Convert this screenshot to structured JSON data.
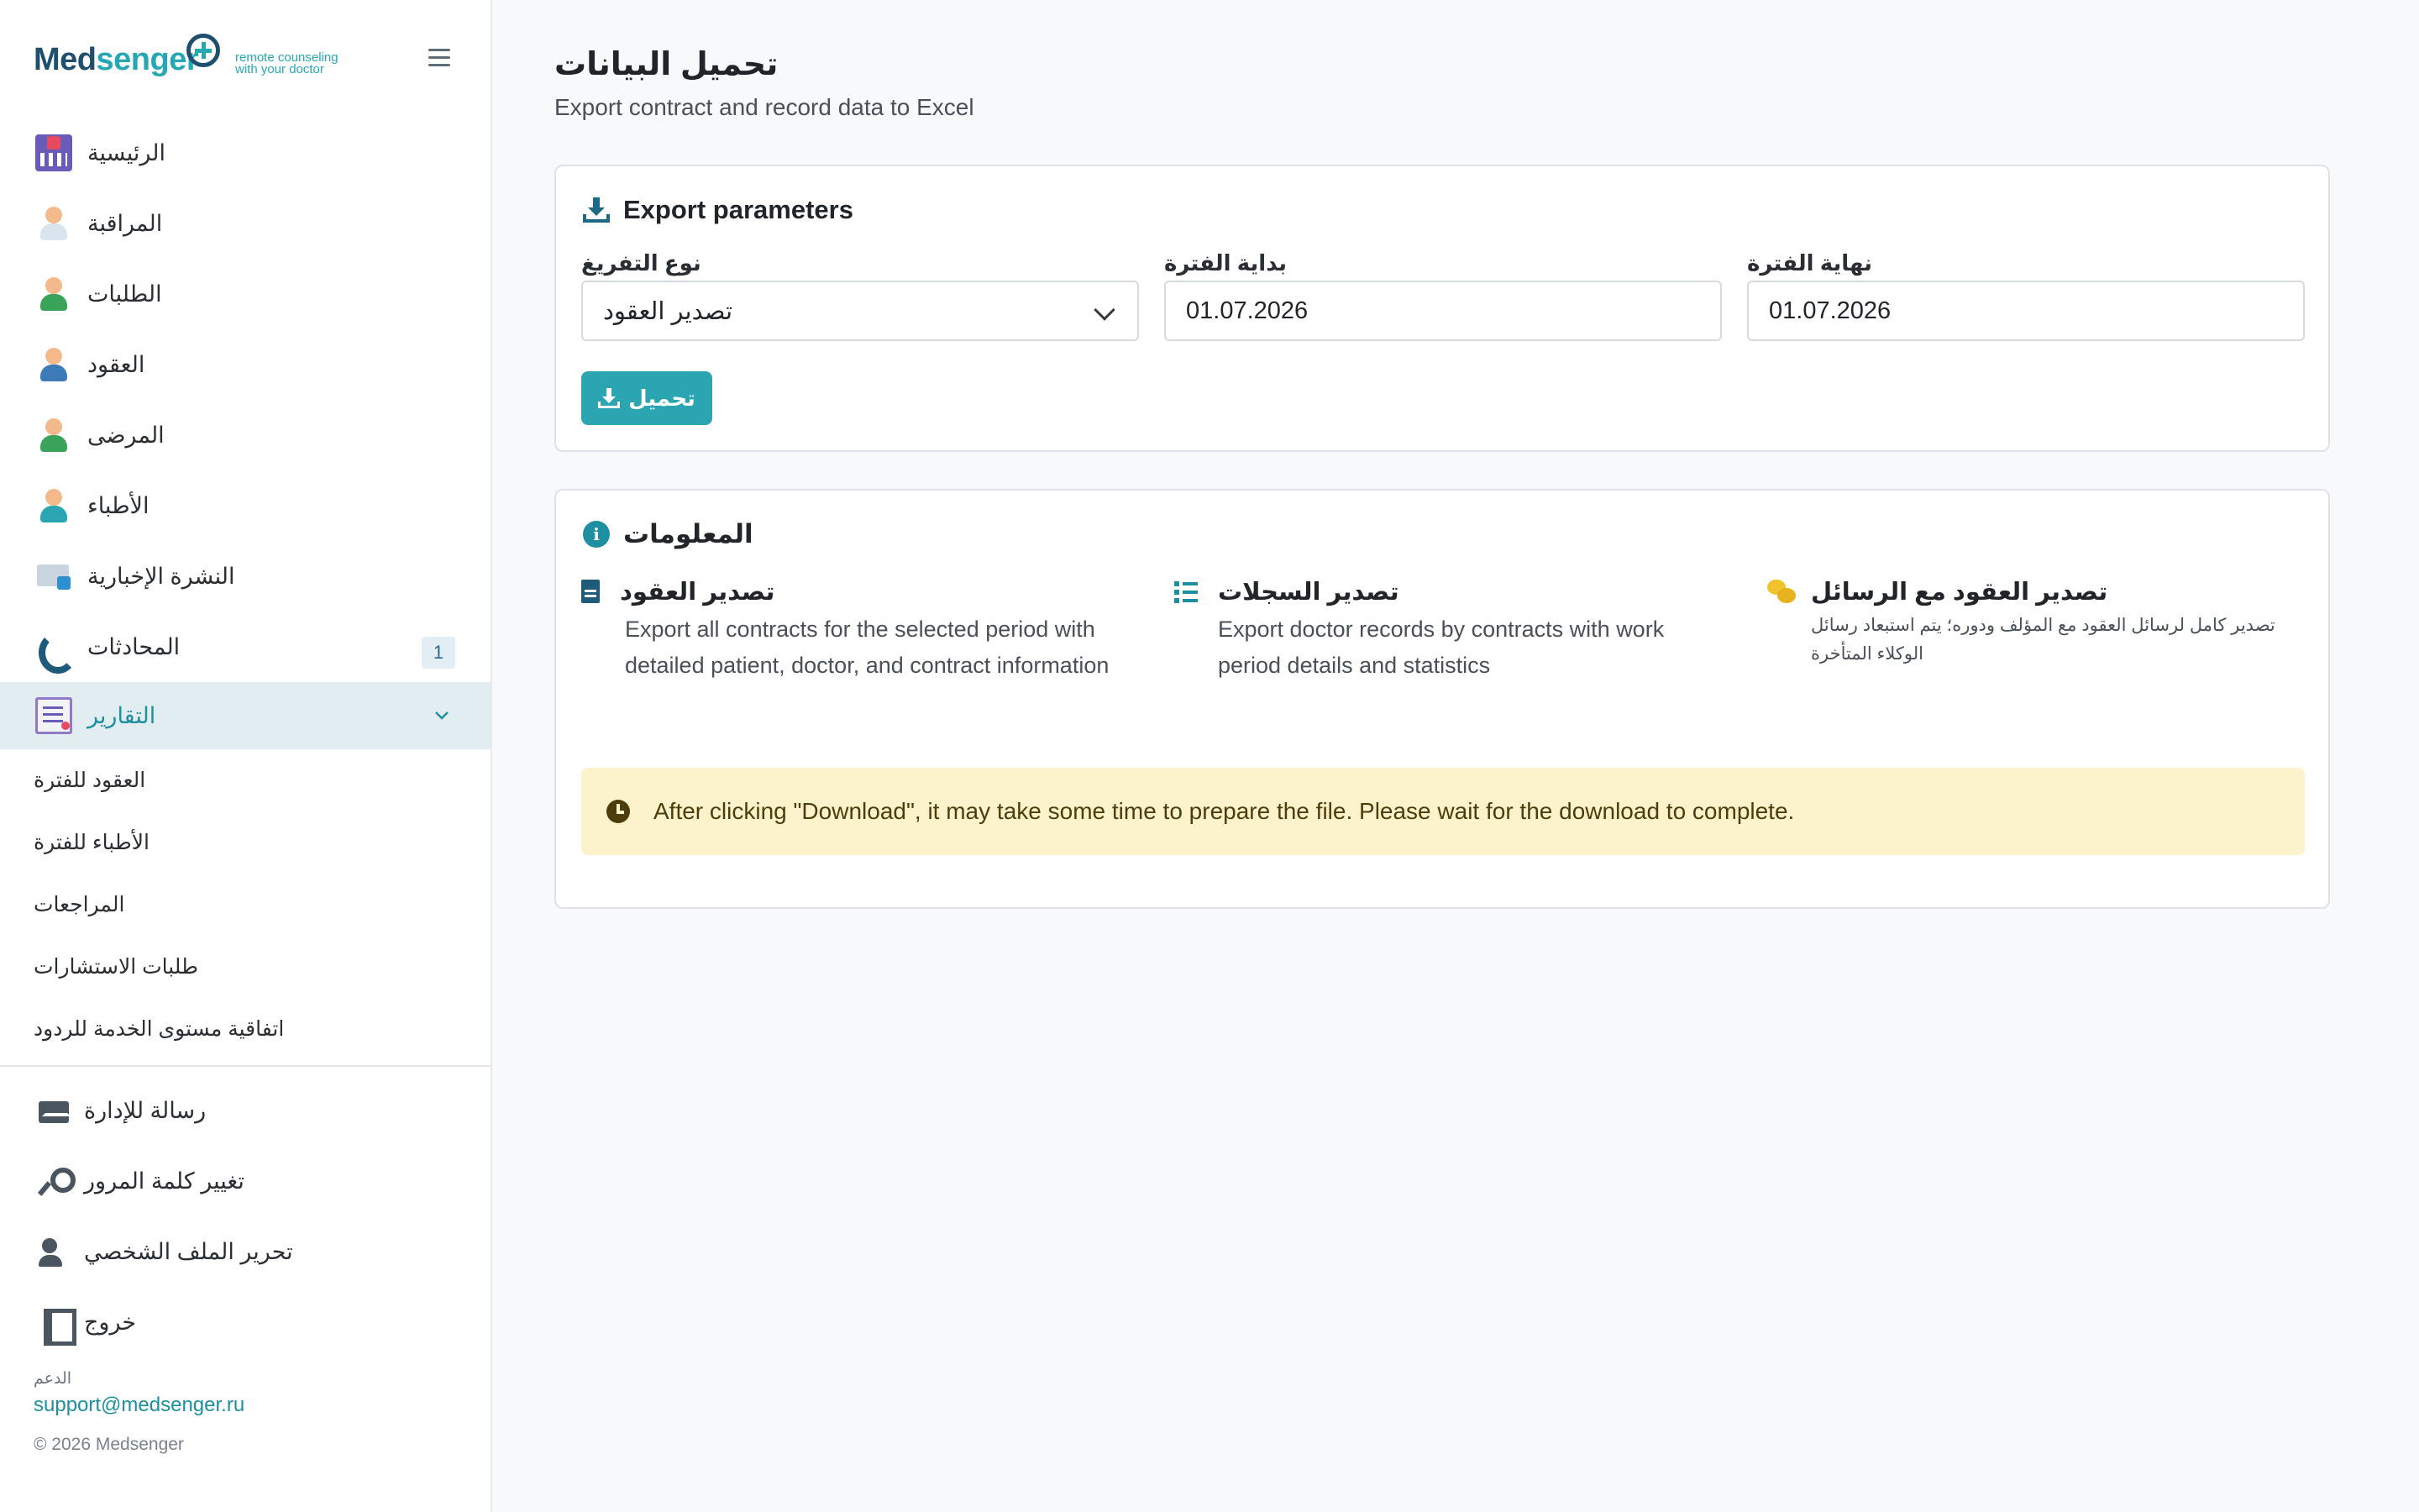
{
  "brand": {
    "name_part1": "Med",
    "name_part2": "senger",
    "tagline_line1": "remote counseling",
    "tagline_line2": "with your doctor",
    "accent_color": "#2aa5b1",
    "dark_color": "#1e4f6e"
  },
  "sidebar": {
    "items": [
      {
        "label": "الرئيسية",
        "icon": "hospital-icon"
      },
      {
        "label": "المراقبة",
        "icon": "doctor-icon"
      },
      {
        "label": "الطلبات",
        "icon": "user-search-icon"
      },
      {
        "label": "العقود",
        "icon": "contract-user-icon"
      },
      {
        "label": "المرضى",
        "icon": "patient-icon"
      },
      {
        "label": "الأطباء",
        "icon": "nurse-icon"
      },
      {
        "label": "النشرة الإخبارية",
        "icon": "newsletter-mail-icon"
      },
      {
        "label": "المحادثات",
        "icon": "phone-icon",
        "badge": "1"
      },
      {
        "label": "التقارير",
        "icon": "report-icon",
        "active": true
      }
    ],
    "reports_submenu": [
      "العقود للفترة",
      "الأطباء للفترة",
      "المراجعات",
      "طلبات الاستشارات",
      "اتفاقية مستوى الخدمة للردود"
    ],
    "bottom_items": [
      {
        "label": "رسالة للإدارة",
        "icon": "envelope-icon"
      },
      {
        "label": "تغيير كلمة المرور",
        "icon": "key-icon"
      },
      {
        "label": "تحرير الملف الشخصي",
        "icon": "user-edit-icon"
      },
      {
        "label": "خروج",
        "icon": "door-exit-icon"
      }
    ],
    "support_caption": "الدعم",
    "support_email": "support@medsenger.ru",
    "copyright": "© 2026 Medsenger"
  },
  "main": {
    "title": "تحميل البيانات",
    "subtitle": "Export contract and record data to Excel",
    "params": {
      "heading": "Export parameters",
      "export_type_label": "نوع التفريغ",
      "export_type_value": "تصدير العقود",
      "period_start_label": "بداية الفترة",
      "period_start_value": "01.07.2026",
      "period_end_label": "نهاية الفترة",
      "period_end_value": "01.07.2026",
      "download_button": "تحميل"
    },
    "info": {
      "heading": "المعلومات",
      "columns": [
        {
          "title": "تصدير العقود",
          "desc": "Export all contracts for the selected period with detailed patient, doctor, and contract information",
          "icon": "file-icon"
        },
        {
          "title": "تصدير السجلات",
          "desc": "Export doctor records by contracts with work period details and statistics",
          "icon": "list-icon"
        },
        {
          "title": "تصدير العقود مع الرسائل",
          "desc": "تصدير كامل لرسائل العقود مع المؤلف ودوره؛ يتم استبعاد رسائل الوكلاء المتأخرة",
          "icon": "chat-icon"
        }
      ],
      "alert": "After clicking \"Download\", it may take some time to prepare the file. Please wait for the download to complete."
    }
  }
}
